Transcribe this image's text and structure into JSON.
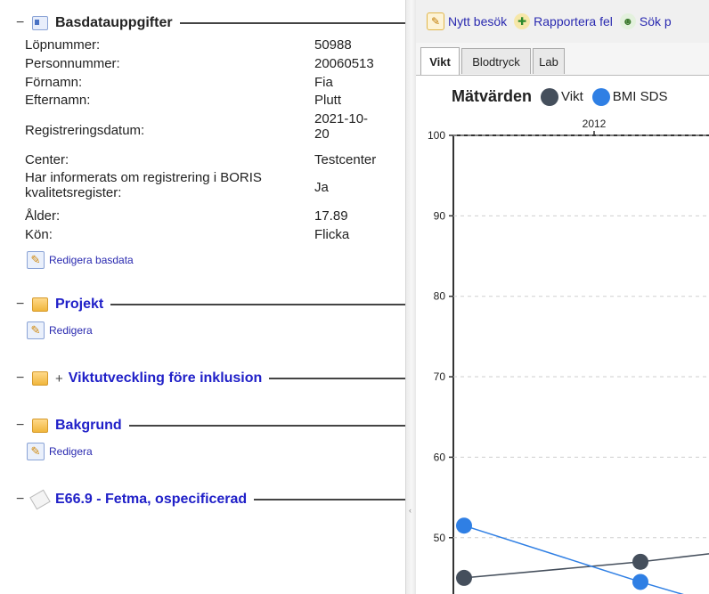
{
  "basdata": {
    "title": "Basdatauppgifter",
    "rows": [
      {
        "label": "Löpnummer:",
        "value": "50988"
      },
      {
        "label": "Personnummer:",
        "value": "20060513"
      },
      {
        "label": "Förnamn:",
        "value": "Fia"
      },
      {
        "label": "Efternamn:",
        "value": "Plutt"
      },
      {
        "label": "Registreringsdatum:",
        "value": "2021-10-20"
      },
      {
        "label": "Center:",
        "value": "Testcenter"
      },
      {
        "label": "Har informerats om registrering i BORIS kvalitetsregister:",
        "value": "Ja"
      },
      {
        "label": "Ålder:",
        "value": "17.89"
      },
      {
        "label": "Kön:",
        "value": "Flicka"
      }
    ],
    "edit_label": "Redigera basdata"
  },
  "projekt": {
    "title": "Projekt",
    "edit_label": "Redigera"
  },
  "viktutveckling": {
    "title": "Viktutveckling före inklusion",
    "expander": "+"
  },
  "bakgrund": {
    "title": "Bakgrund",
    "edit_label": "Redigera"
  },
  "diagnos": {
    "title": "E66.9 - Fetma, ospecificerad"
  },
  "collapse_glyph": "−",
  "toolbar": {
    "new_visit": "Nytt besök",
    "report_error": "Rapportera fel",
    "search": "Sök p"
  },
  "tabs": [
    "Vikt",
    "Blodtryck",
    "Lab"
  ],
  "colors": {
    "vikt": "#454f5c",
    "bmi": "#2f7fe4",
    "link": "#2020c8"
  },
  "chart_data": {
    "type": "line",
    "title": "Mätvärden",
    "legend_position": "top",
    "x_tick_labels": [
      "2012"
    ],
    "y_ticks": [
      50,
      60,
      70,
      80,
      90,
      100
    ],
    "ylim": [
      43,
      100
    ],
    "grid": true,
    "series": [
      {
        "name": "Vikt",
        "points": [
          {
            "x": 0.0,
            "y": 45
          },
          {
            "x": 0.72,
            "y": 47
          },
          {
            "x": 1.0,
            "y": 48
          }
        ]
      },
      {
        "name": "BMI SDS",
        "points": [
          {
            "x": 0.0,
            "y": 51.5
          },
          {
            "x": 0.72,
            "y": 44.5
          },
          {
            "x": 1.0,
            "y": 42
          }
        ]
      }
    ]
  }
}
